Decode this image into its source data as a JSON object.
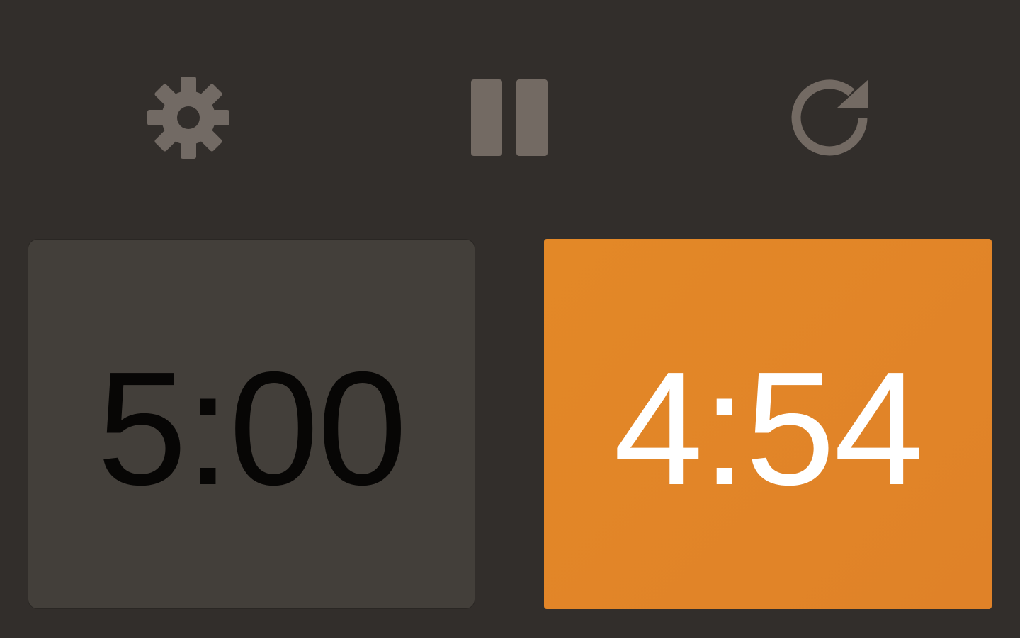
{
  "toolbar": {
    "settings": {
      "icon": "gear-icon",
      "color": "#726a64"
    },
    "pause": {
      "icon": "pause-icon",
      "color": "#736a63"
    },
    "reset": {
      "icon": "reset-icon",
      "color": "#736a63"
    }
  },
  "clocks": {
    "left": {
      "time": "5:00",
      "background": "#433f3a",
      "text_color": "#070605"
    },
    "right": {
      "time": "4:54",
      "background": "#e28427",
      "text_color": "#ffffff",
      "active": true
    }
  },
  "colors": {
    "background": "#322e2b",
    "accent": "#e28427"
  }
}
